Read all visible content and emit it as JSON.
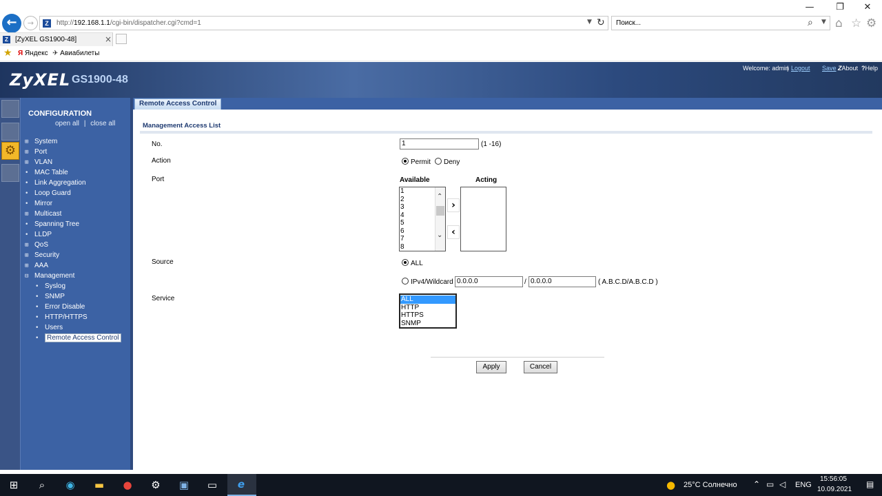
{
  "browser": {
    "window_controls": {
      "minimize": "—",
      "maximize": "❐",
      "close": "✕"
    },
    "back_icon": "back-arrow-icon",
    "url_prefix": "http://",
    "url_host": "192.168.1.1",
    "url_path": "/cgi-bin/dispatcher.cgi?cmd=1",
    "search_placeholder": "Поиск...",
    "tab_title": "[ZyXEL GS1900-48]",
    "favorites": [
      "Яндекс",
      "Авиабилеты"
    ]
  },
  "header": {
    "logo": "ZyXEL",
    "model": "GS1900-48",
    "welcome": "Welcome: admin",
    "logout": "Logout",
    "save": "Save",
    "about": "About",
    "help": "Help"
  },
  "sidebar": {
    "title": "CONFIGURATION",
    "open_all": "open all",
    "separator": "|",
    "close_all": "close all",
    "items": [
      {
        "label": "System",
        "marker": "⊞"
      },
      {
        "label": "Port",
        "marker": "⊞"
      },
      {
        "label": "VLAN",
        "marker": "⊞"
      },
      {
        "label": "MAC Table",
        "marker": "•"
      },
      {
        "label": "Link Aggregation",
        "marker": "•"
      },
      {
        "label": "Loop Guard",
        "marker": "•"
      },
      {
        "label": "Mirror",
        "marker": "•"
      },
      {
        "label": "Multicast",
        "marker": "⊞"
      },
      {
        "label": "Spanning Tree",
        "marker": "•"
      },
      {
        "label": "LLDP",
        "marker": "•"
      },
      {
        "label": "QoS",
        "marker": "⊞"
      },
      {
        "label": "Security",
        "marker": "⊞"
      },
      {
        "label": "AAA",
        "marker": "⊞"
      },
      {
        "label": "Management",
        "marker": "⊟"
      }
    ],
    "subitems": [
      {
        "label": "Syslog"
      },
      {
        "label": "SNMP"
      },
      {
        "label": "Error Disable"
      },
      {
        "label": "HTTP/HTTPS"
      },
      {
        "label": "Users"
      },
      {
        "label": "Remote Access Control"
      }
    ]
  },
  "content": {
    "tab": "Remote Access Control",
    "section_title": "Management Access List",
    "fields": {
      "no_label": "No.",
      "no_value": "1",
      "no_hint": "(1 -16)",
      "action_label": "Action",
      "permit": "Permit",
      "deny": "Deny",
      "port_label": "Port",
      "available": "Available",
      "acting": "Acting",
      "available_ports": [
        "1",
        "2",
        "3",
        "4",
        "5",
        "6",
        "7",
        "8"
      ],
      "source_label": "Source",
      "source_all": "ALL",
      "source_ipv4": "IPv4/Wildcard",
      "ip_value": "0.0.0.0",
      "slash": "/",
      "wildcard_value": "0.0.0.0",
      "ip_hint": "( A.B.C.D/A.B.C.D )",
      "service_label": "Service",
      "services": [
        "ALL",
        "HTTP",
        "HTTPS",
        "SNMP"
      ]
    },
    "apply": "Apply",
    "cancel": "Cancel"
  },
  "taskbar": {
    "weather": "25°C  Солнечно",
    "lang": "ENG",
    "time": "15:56:05",
    "date": "10.09.2021"
  }
}
